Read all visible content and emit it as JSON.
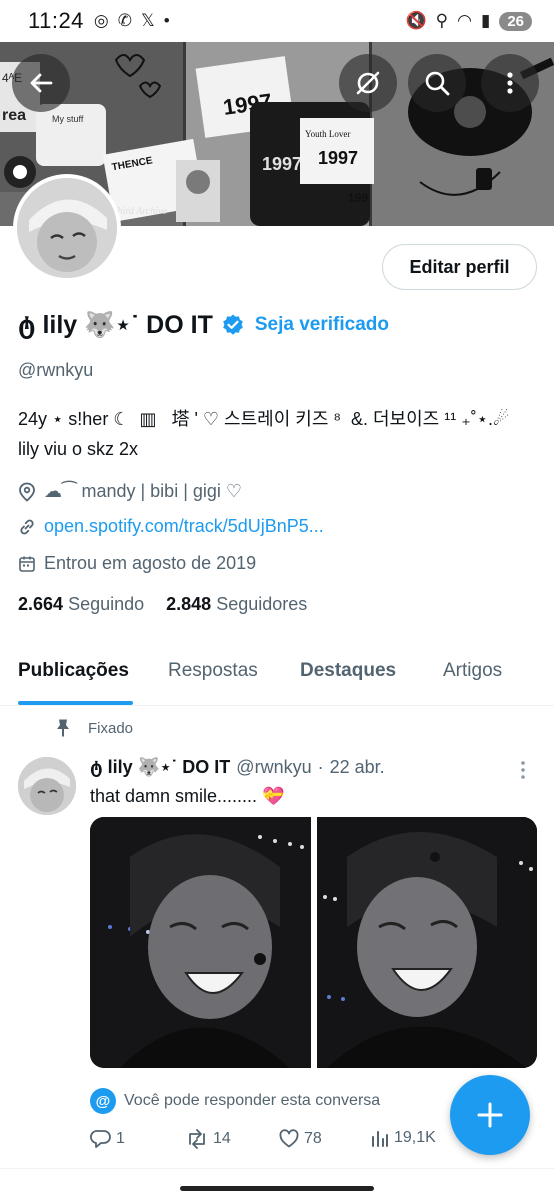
{
  "status_bar": {
    "time": "11:24",
    "left_icons": [
      "threads-icon",
      "whatsapp-icon",
      "x-icon",
      "dot-icon"
    ],
    "left_glyphs": [
      "◎",
      "✆",
      "𝕏",
      "•"
    ],
    "right_glyphs": [
      "🔇",
      "⚲",
      "◠",
      "▮"
    ],
    "battery": "26"
  },
  "banner": {
    "left_text_a": "4ᴬE",
    "left_text_b": "rea",
    "mug_label": "My stuff",
    "magazine_text": "1997",
    "book_title": "THENCE",
    "book_sub": "Third Archive",
    "ticket_text_a": "1997",
    "ticket_text_b": "1997",
    "ticket_text_c": "199",
    "youth_text": "Youth Lover"
  },
  "profile": {
    "edit_button": "Editar perfil",
    "display_name": "ტ lily 🐺⋆˙ DO IT",
    "verify_link": "Seja verificado",
    "handle": "@rwnkyu",
    "bio_line1": "24y ⋆ s!her ☾  ▥   塔 ' ♡ 스트레이 키즈 ⁸  &. 더보이즈 ¹¹ ₊˚⋆.☄",
    "bio_line2": "lily viu o skz 2x",
    "location": "☁︎⁀  mandy | bibi | gigi ♡",
    "website": "open.spotify.com/track/5dUjBnP5...",
    "joined": "Entrou em agosto de 2019",
    "following_count": "2.664",
    "following_label": "Seguindo",
    "followers_count": "2.848",
    "followers_label": "Seguidores"
  },
  "tabs": [
    "Publicações",
    "Respostas",
    "Destaques",
    "Artigos"
  ],
  "active_tab": "Publicações",
  "tweet": {
    "pinned_label": "Fixado",
    "name": "ტ lily 🐺⋆˙ DO IT",
    "handle": "@rwnkyu",
    "separator": "·",
    "date": "22 abr.",
    "text": "that damn smile........ 💝",
    "reply_note": "Você pode responder esta conversa",
    "replies": "1",
    "reposts": "14",
    "likes": "78",
    "views": "19,1K"
  },
  "colors": {
    "accent": "#1d9bf0",
    "text_primary": "#0f1419",
    "text_secondary": "#536471"
  }
}
